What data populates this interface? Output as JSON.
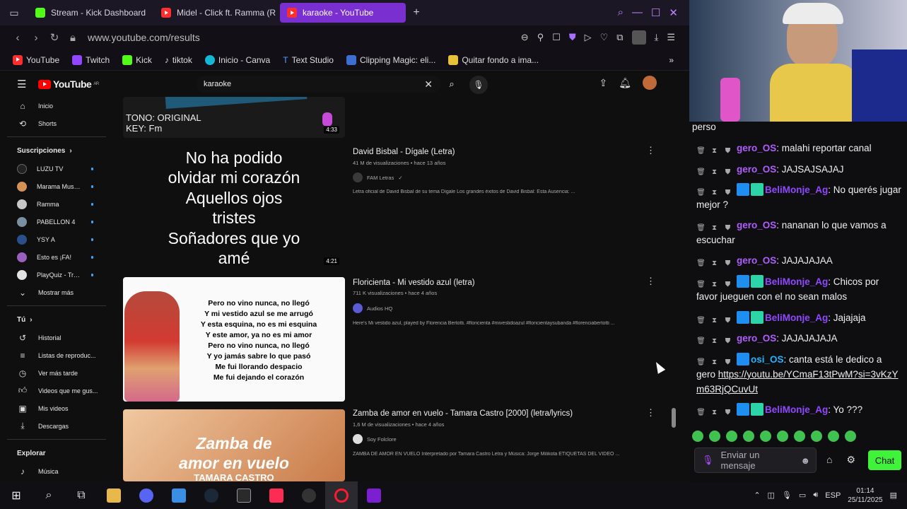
{
  "browser": {
    "tabs": [
      {
        "title": "Stream - Kick Dashboard",
        "icon": "kick-icon"
      },
      {
        "title": "Midel - Click ft. Ramma (R",
        "icon": "youtube-icon"
      },
      {
        "title": "karaoke - YouTube",
        "icon": "youtube-icon",
        "active": true
      }
    ],
    "url": "www.youtube.com/results",
    "bookmarks": [
      "YouTube",
      "Twitch",
      "Kick",
      "tiktok",
      "Inicio - Canva",
      "Text Studio",
      "Clipping Magic: eli...",
      "Quitar fondo a ima..."
    ],
    "accent": "#7a2fd0"
  },
  "youtube": {
    "logo_text": "YouTube",
    "logo_region": "AR",
    "search_value": "karaoke",
    "sidebar": {
      "main": [
        "Inicio",
        "Shorts"
      ],
      "subs_header": "Suscripciones",
      "subs": [
        "LUZU TV",
        "Marama Musica...",
        "Ramma",
        "PABELLON 4",
        "YSY A",
        "Esto es ¡FA!",
        "PlayQuiz - Trivia"
      ],
      "show_more": "Mostrar más",
      "you_header": "Tú",
      "you_items": [
        "Historial",
        "Listas de reproduc...",
        "Ver más tarde",
        "Videos que me gus...",
        "Mis videos",
        "Descargas"
      ],
      "explore_header": "Explorar",
      "explore_items": [
        "Música"
      ]
    },
    "results": [
      {
        "thumb_lines": [
          "TONO: ORIGINAL",
          "KEY: Fm"
        ],
        "duration": "4:33"
      },
      {
        "thumb_lyrics": [
          "No ha podido",
          "olvidar mi corazón",
          "Aquellos ojos",
          "tristes",
          "Soñadores que yo",
          "amé"
        ],
        "duration": "4:21",
        "title": "David Bisbal - Dígale (Letra)",
        "meta": "41 M de visualizaciones • hace 13 años",
        "channel": "FAM Letras",
        "desc": "Letra oficial de David Bisbal de su tema Dígale Los grandes éxitos de David Bisbal: Esta Ausencia: ..."
      },
      {
        "thumb_lyrics": [
          "Pero no vino nunca, no llegó",
          "Y mi vestido azul se me arrugó",
          "Y esta esquina, no es mi esquina",
          "Y este amor, ya no es mi amor",
          "Pero no vino nunca, no llegó",
          "Y yo jamás sabre lo que pasó",
          "Me fui llorando despacio",
          "Me fui dejando el corazón"
        ],
        "title": "Floricienta - Mi vestido azul (letra)",
        "meta": "711 K visualizaciones • hace 4 años",
        "channel": "Audios HQ",
        "desc": "Here's Mi vestido azul, played by Florencia Bertotti. #floricienta #mivestidoazul #floricientaysubanda #florenciabertotti ..."
      },
      {
        "thumb_lines": [
          "Zamba de",
          "amor en vuelo",
          "TAMARA CASTRO"
        ],
        "title": "Zamba de amor en vuelo - Tamara Castro [2000] (letra/lyrics)",
        "meta": "1,6 M de visualizaciones • hace 4 años",
        "channel": "Soy Folclore",
        "desc": "ZAMBA DE AMOR EN VUELO Interpretado por Tamara Castro Letra y Música: Jorge Milikota ETIQUETAS DEL VIDEO ..."
      }
    ]
  },
  "chat": {
    "first_line": "perso",
    "messages": [
      {
        "user": "gero_OS",
        "text": ": malahi reportar canal"
      },
      {
        "user": "gero_OS",
        "text": ": JAJSAJSAJAJ"
      },
      {
        "user": "BeliMonje_Ag",
        "text": ": No querés jugar mejor ?"
      },
      {
        "user": "gero_OS",
        "text": ": nananan lo que vamos a escuchar"
      },
      {
        "user": "gero_OS",
        "text": ": JAJAJAJAA"
      },
      {
        "user": "BeliMonje_Ag",
        "text": ": Chicos por favor jueguen con el no sean malos"
      },
      {
        "user": "BeliMonje_Ag",
        "text": ": Jajajaja"
      },
      {
        "user": "gero_OS",
        "text": ": JAJAJAJAJA"
      },
      {
        "user": "osi_OS",
        "text": ": canta está le dedico a gero ",
        "link": "https://youtu.be/YCmaF13tPwM?si=3vKzYm63RjQCuvUt"
      },
      {
        "user": "BeliMonje_Ag",
        "text": ": Yo ???"
      }
    ],
    "input_placeholder": "Enviar un mensaje",
    "send_label": "Chat"
  },
  "taskbar": {
    "lang": "ESP",
    "time": "01:14",
    "date": "25/11/2025"
  }
}
